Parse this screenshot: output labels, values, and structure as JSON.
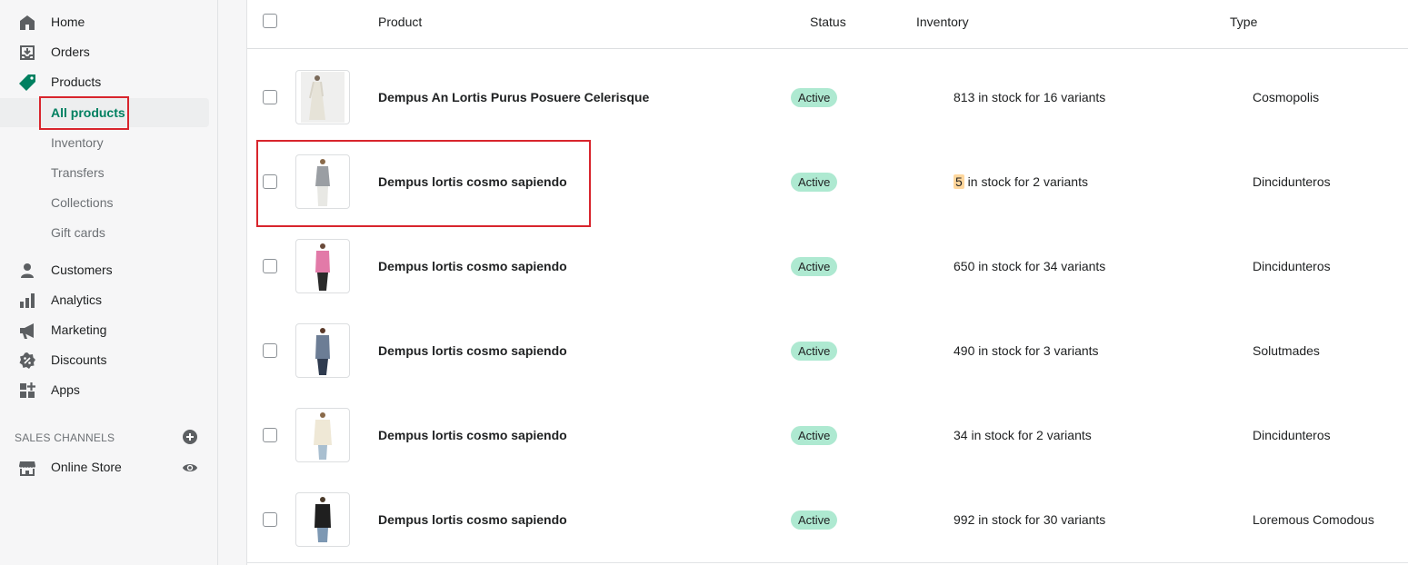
{
  "sidebar": {
    "nav": [
      {
        "label": "Home",
        "icon": "home-icon"
      },
      {
        "label": "Orders",
        "icon": "orders-icon"
      },
      {
        "label": "Products",
        "icon": "tag-icon"
      }
    ],
    "products_sub": [
      {
        "label": "All products",
        "active": true
      },
      {
        "label": "Inventory"
      },
      {
        "label": "Transfers"
      },
      {
        "label": "Collections"
      },
      {
        "label": "Gift cards"
      }
    ],
    "nav2": [
      {
        "label": "Customers",
        "icon": "person-icon"
      },
      {
        "label": "Analytics",
        "icon": "bar-chart-icon"
      },
      {
        "label": "Marketing",
        "icon": "megaphone-icon"
      },
      {
        "label": "Discounts",
        "icon": "discount-icon"
      },
      {
        "label": "Apps",
        "icon": "apps-icon"
      }
    ],
    "sales_channels_title": "SALES CHANNELS",
    "online_store": "Online Store",
    "accent_color": "#008060"
  },
  "table": {
    "headers": {
      "product": "Product",
      "status": "Status",
      "inventory": "Inventory",
      "type": "Type"
    },
    "rows": [
      {
        "name": "Dempus An Lortis Purus Posuere Celerisque",
        "status": "Active",
        "inv_count": "813",
        "inv_rest": " in stock for 16 variants",
        "type": "Cosmopolis",
        "low": false
      },
      {
        "name": "Dempus lortis cosmo sapiendo",
        "status": "Active",
        "inv_count": "5",
        "inv_rest": " in stock for 2 variants",
        "type": "Dincidunteros",
        "low": true
      },
      {
        "name": "Dempus lortis cosmo sapiendo",
        "status": "Active",
        "inv_count": "650",
        "inv_rest": " in stock for 34 variants",
        "type": "Dincidunteros",
        "low": false
      },
      {
        "name": "Dempus lortis cosmo sapiendo",
        "status": "Active",
        "inv_count": "490",
        "inv_rest": " in stock for 3 variants",
        "type": "Solutmades",
        "low": false
      },
      {
        "name": "Dempus lortis cosmo sapiendo",
        "status": "Active",
        "inv_count": "34",
        "inv_rest": " in stock for 2 variants",
        "type": "Dincidunteros",
        "low": false
      },
      {
        "name": "Dempus lortis cosmo sapiendo",
        "status": "Active",
        "inv_count": "992",
        "inv_rest": " in stock for 30 variants",
        "type": "Loremous Comodous",
        "low": false
      }
    ],
    "badge_color": "#aee9d1",
    "low_stock_color": "#ffd79d"
  }
}
